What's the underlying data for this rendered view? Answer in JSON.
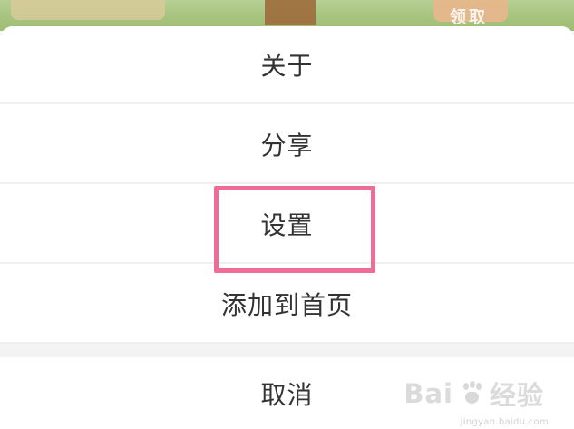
{
  "background": {
    "partial_label": "领取"
  },
  "menu": {
    "items": [
      {
        "label": "关于"
      },
      {
        "label": "分享"
      },
      {
        "label": "设置"
      },
      {
        "label": "添加到首页"
      }
    ],
    "cancel": "取消"
  },
  "watermark": {
    "brand": "Bai",
    "suffix": "经验",
    "site": "jingyan.baidu.com"
  },
  "colors": {
    "text": "#333333",
    "divider": "#efefef",
    "highlight": "#ee6c95"
  }
}
